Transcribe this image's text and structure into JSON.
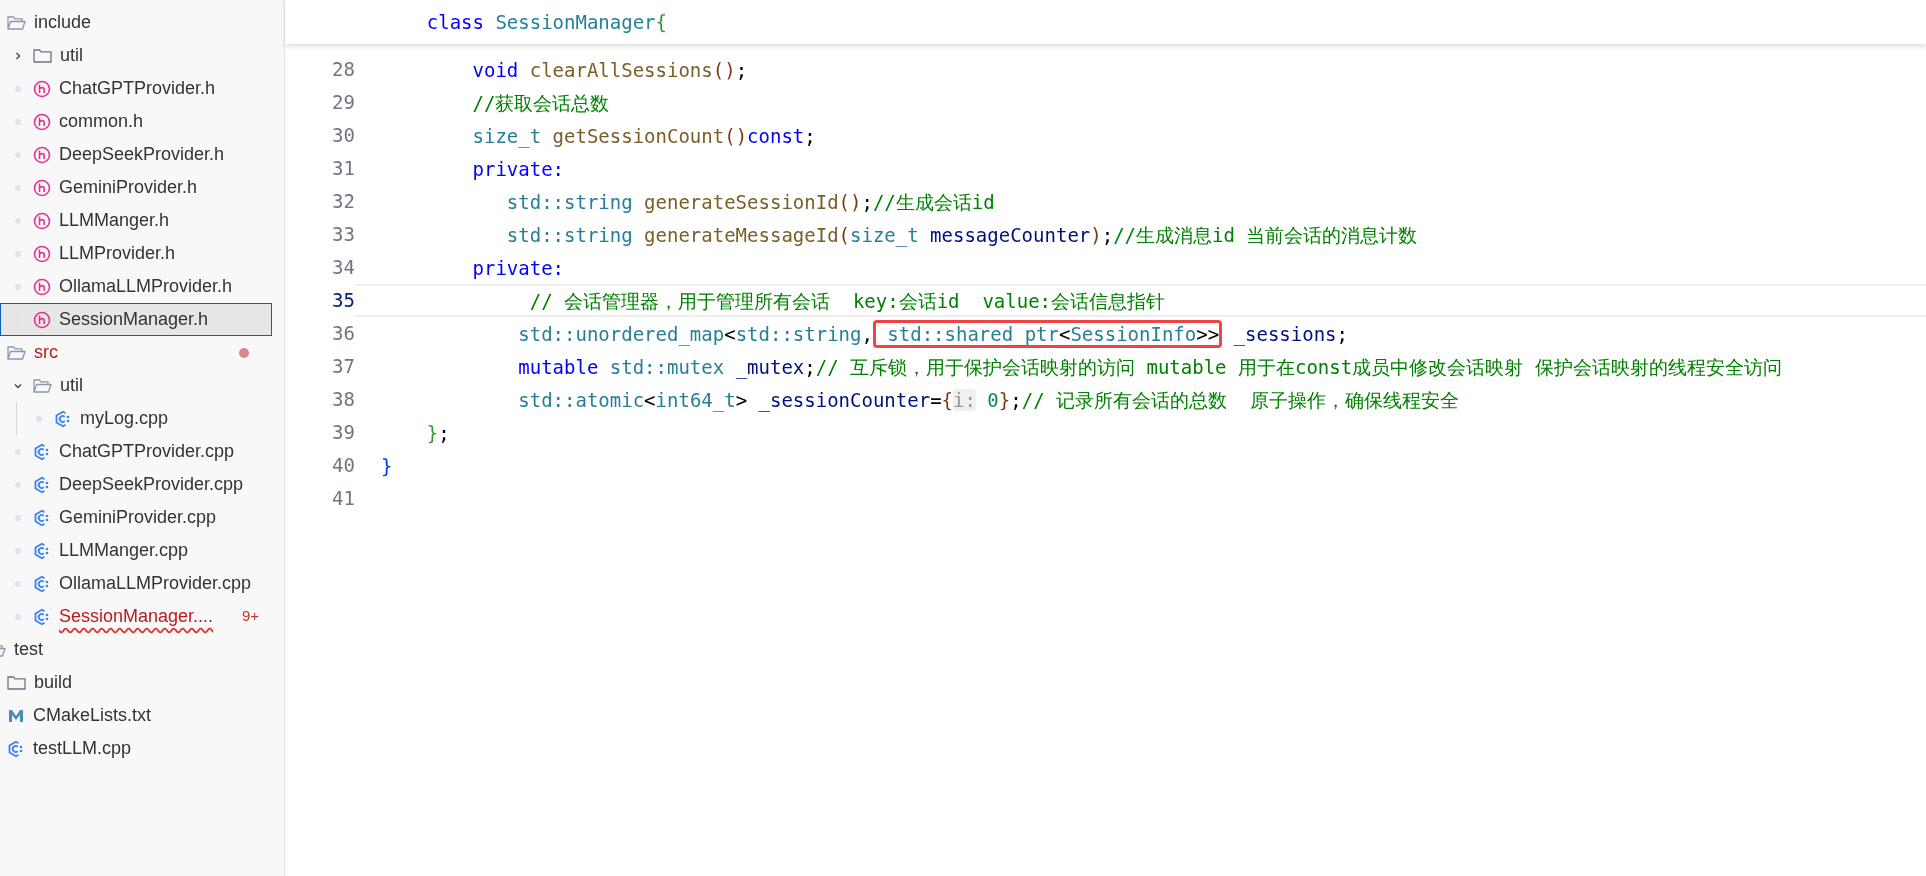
{
  "explorer": {
    "items": [
      {
        "kind": "folder",
        "label": "include",
        "expanded": true,
        "children": [
          {
            "kind": "folder",
            "label": "util",
            "expanded": false
          },
          {
            "kind": "h",
            "label": "ChatGPTProvider.h"
          },
          {
            "kind": "h",
            "label": "common.h"
          },
          {
            "kind": "h",
            "label": "DeepSeekProvider.h"
          },
          {
            "kind": "h",
            "label": "GeminiProvider.h"
          },
          {
            "kind": "h",
            "label": "LLMManger.h"
          },
          {
            "kind": "h",
            "label": "LLMProvider.h"
          },
          {
            "kind": "h",
            "label": "OllamaLLMProvider.h"
          },
          {
            "kind": "h",
            "label": "SessionManager.h",
            "selected": true
          }
        ]
      },
      {
        "kind": "folder",
        "label": "src",
        "expanded": true,
        "error": true,
        "modified": true,
        "children": [
          {
            "kind": "folder",
            "label": "util",
            "expanded": true,
            "children": [
              {
                "kind": "cpp",
                "label": "myLog.cpp"
              }
            ]
          },
          {
            "kind": "cpp",
            "label": "ChatGPTProvider.cpp"
          },
          {
            "kind": "cpp",
            "label": "DeepSeekProvider.cpp"
          },
          {
            "kind": "cpp",
            "label": "GeminiProvider.cpp"
          },
          {
            "kind": "cpp",
            "label": "LLMManger.cpp"
          },
          {
            "kind": "cpp",
            "label": "OllamaLLMProvider.cpp"
          },
          {
            "kind": "cpp",
            "label": "SessionManager....",
            "error": true,
            "badge": "9+"
          }
        ]
      },
      {
        "kind": "root",
        "label": "test"
      },
      {
        "kind": "folder",
        "label": "build",
        "expanded": false
      },
      {
        "kind": "cmake",
        "label": "CMakeLists.txt"
      },
      {
        "kind": "cpp",
        "label": "testLLM.cpp"
      }
    ]
  },
  "editor": {
    "sticky_line": [
      {
        "kind": "keyword",
        "t": "    class "
      },
      {
        "kind": "type",
        "t": "SessionManager"
      },
      {
        "kind": "bracket2",
        "t": "{"
      }
    ],
    "lines": [
      {
        "number": "28",
        "current": false,
        "tokens": [
          {
            "kind": "keyword",
            "t": "        void "
          },
          {
            "kind": "func",
            "t": "clearAllSessions"
          },
          {
            "kind": "bracket3",
            "t": "()"
          },
          {
            "kind": "plain",
            "t": ";"
          }
        ]
      },
      {
        "number": "29",
        "current": false,
        "tokens": [
          {
            "kind": "comment",
            "t": "        //获取会话总数"
          }
        ]
      },
      {
        "number": "30",
        "current": false,
        "tokens": [
          {
            "kind": "type",
            "t": "        size_t "
          },
          {
            "kind": "func",
            "t": "getSessionCount"
          },
          {
            "kind": "bracket3",
            "t": "()"
          },
          {
            "kind": "keyword",
            "t": "const"
          },
          {
            "kind": "plain",
            "t": ";"
          }
        ]
      },
      {
        "number": "31",
        "current": false,
        "tokens": [
          {
            "kind": "keyword",
            "t": "        private:"
          }
        ]
      },
      {
        "number": "32",
        "current": false,
        "tokens": [
          {
            "kind": "type",
            "t": "           std::string "
          },
          {
            "kind": "func",
            "t": "generateSessionId"
          },
          {
            "kind": "bracket3",
            "t": "()"
          },
          {
            "kind": "plain",
            "t": ";"
          },
          {
            "kind": "comment",
            "t": "//生成会话id"
          }
        ]
      },
      {
        "number": "33",
        "current": false,
        "tokens": [
          {
            "kind": "type",
            "t": "           std::string "
          },
          {
            "kind": "func",
            "t": "generateMessageId"
          },
          {
            "kind": "bracket3",
            "t": "("
          },
          {
            "kind": "type",
            "t": "size_t "
          },
          {
            "kind": "var",
            "t": "messageCounter"
          },
          {
            "kind": "bracket3",
            "t": ")"
          },
          {
            "kind": "plain",
            "t": ";"
          },
          {
            "kind": "comment",
            "t": "//生成消息id 当前会话的消息计数"
          }
        ]
      },
      {
        "number": "34",
        "current": false,
        "tokens": [
          {
            "kind": "keyword",
            "t": "        private:"
          }
        ]
      },
      {
        "number": "35",
        "current": true,
        "tokens": [
          {
            "kind": "comment",
            "t": "             // 会话管理器，用于管理所有会话  key:会话id  value:会话信息指针"
          }
        ]
      },
      {
        "number": "36",
        "current": false,
        "tokens": [
          {
            "kind": "type",
            "t": "            std::unordered_map"
          },
          {
            "kind": "plain",
            "t": "<"
          },
          {
            "kind": "type",
            "t": "std::string"
          },
          {
            "kind": "plain",
            "t": ","
          },
          {
            "kind": "box",
            "tokens": [
              {
                "kind": "type",
                "t": " std::shared_ptr"
              },
              {
                "kind": "plain",
                "t": "<"
              },
              {
                "kind": "type",
                "t": "SessionInfo"
              },
              {
                "kind": "plain",
                "t": ">>"
              }
            ]
          },
          {
            "kind": "var",
            "t": " _sessions"
          },
          {
            "kind": "plain",
            "t": ";"
          }
        ]
      },
      {
        "number": "37",
        "current": false,
        "tokens": [
          {
            "kind": "keyword",
            "t": "            mutable "
          },
          {
            "kind": "type",
            "t": "std::mutex "
          },
          {
            "kind": "var",
            "t": "_mutex"
          },
          {
            "kind": "plain",
            "t": ";"
          },
          {
            "kind": "comment",
            "t": "// 互斥锁，用于保护会话映射的访问 mutable 用于在const成员中修改会话映射 保护会话映射的线程安全访问"
          }
        ]
      },
      {
        "number": "38",
        "current": false,
        "tokens": [
          {
            "kind": "type",
            "t": "            std::atomic"
          },
          {
            "kind": "plain",
            "t": "<"
          },
          {
            "kind": "type",
            "t": "int64_t"
          },
          {
            "kind": "plain",
            "t": ">"
          },
          {
            "kind": "var",
            "t": " _sessionCounter"
          },
          {
            "kind": "plain",
            "t": "="
          },
          {
            "kind": "bracket3",
            "t": "{"
          },
          {
            "kind": "hint",
            "t": "i:"
          },
          {
            "kind": "number",
            "t": " 0"
          },
          {
            "kind": "bracket3",
            "t": "}"
          },
          {
            "kind": "plain",
            "t": ";"
          },
          {
            "kind": "comment",
            "t": "// 记录所有会话的总数  原子操作，确保线程安全"
          }
        ]
      },
      {
        "number": "39",
        "current": false,
        "tokens": [
          {
            "kind": "bracket2",
            "t": "    }"
          },
          {
            "kind": "plain",
            "t": ";"
          }
        ]
      },
      {
        "number": "40",
        "current": false,
        "tokens": [
          {
            "kind": "bracket1",
            "t": "}"
          }
        ]
      },
      {
        "number": "41",
        "current": false
      }
    ]
  }
}
